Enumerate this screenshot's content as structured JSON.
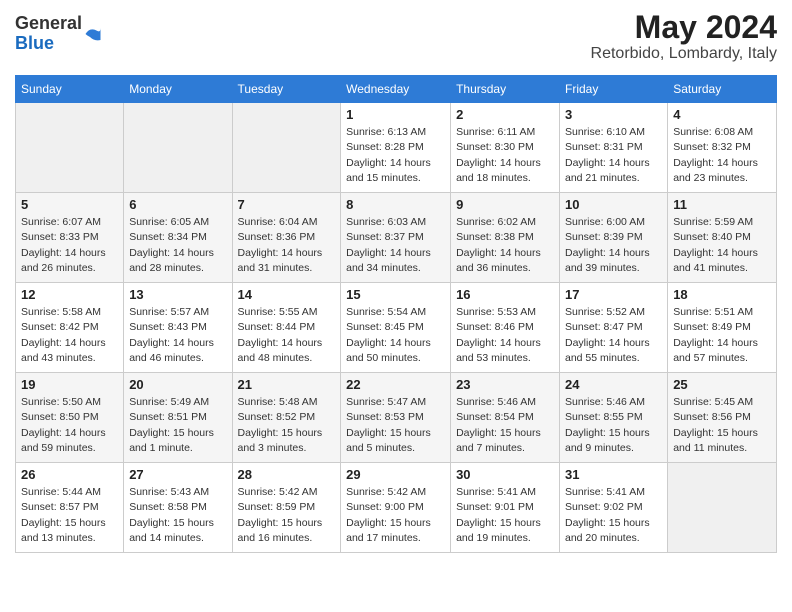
{
  "logo": {
    "general": "General",
    "blue": "Blue"
  },
  "title": {
    "month_year": "May 2024",
    "location": "Retorbido, Lombardy, Italy"
  },
  "weekdays": [
    "Sunday",
    "Monday",
    "Tuesday",
    "Wednesday",
    "Thursday",
    "Friday",
    "Saturday"
  ],
  "weeks": [
    [
      null,
      null,
      null,
      {
        "day": 1,
        "sunrise": "6:13 AM",
        "sunset": "8:28 PM",
        "daylight": "14 hours and 15 minutes."
      },
      {
        "day": 2,
        "sunrise": "6:11 AM",
        "sunset": "8:30 PM",
        "daylight": "14 hours and 18 minutes."
      },
      {
        "day": 3,
        "sunrise": "6:10 AM",
        "sunset": "8:31 PM",
        "daylight": "14 hours and 21 minutes."
      },
      {
        "day": 4,
        "sunrise": "6:08 AM",
        "sunset": "8:32 PM",
        "daylight": "14 hours and 23 minutes."
      }
    ],
    [
      {
        "day": 5,
        "sunrise": "6:07 AM",
        "sunset": "8:33 PM",
        "daylight": "14 hours and 26 minutes."
      },
      {
        "day": 6,
        "sunrise": "6:05 AM",
        "sunset": "8:34 PM",
        "daylight": "14 hours and 28 minutes."
      },
      {
        "day": 7,
        "sunrise": "6:04 AM",
        "sunset": "8:36 PM",
        "daylight": "14 hours and 31 minutes."
      },
      {
        "day": 8,
        "sunrise": "6:03 AM",
        "sunset": "8:37 PM",
        "daylight": "14 hours and 34 minutes."
      },
      {
        "day": 9,
        "sunrise": "6:02 AM",
        "sunset": "8:38 PM",
        "daylight": "14 hours and 36 minutes."
      },
      {
        "day": 10,
        "sunrise": "6:00 AM",
        "sunset": "8:39 PM",
        "daylight": "14 hours and 39 minutes."
      },
      {
        "day": 11,
        "sunrise": "5:59 AM",
        "sunset": "8:40 PM",
        "daylight": "14 hours and 41 minutes."
      }
    ],
    [
      {
        "day": 12,
        "sunrise": "5:58 AM",
        "sunset": "8:42 PM",
        "daylight": "14 hours and 43 minutes."
      },
      {
        "day": 13,
        "sunrise": "5:57 AM",
        "sunset": "8:43 PM",
        "daylight": "14 hours and 46 minutes."
      },
      {
        "day": 14,
        "sunrise": "5:55 AM",
        "sunset": "8:44 PM",
        "daylight": "14 hours and 48 minutes."
      },
      {
        "day": 15,
        "sunrise": "5:54 AM",
        "sunset": "8:45 PM",
        "daylight": "14 hours and 50 minutes."
      },
      {
        "day": 16,
        "sunrise": "5:53 AM",
        "sunset": "8:46 PM",
        "daylight": "14 hours and 53 minutes."
      },
      {
        "day": 17,
        "sunrise": "5:52 AM",
        "sunset": "8:47 PM",
        "daylight": "14 hours and 55 minutes."
      },
      {
        "day": 18,
        "sunrise": "5:51 AM",
        "sunset": "8:49 PM",
        "daylight": "14 hours and 57 minutes."
      }
    ],
    [
      {
        "day": 19,
        "sunrise": "5:50 AM",
        "sunset": "8:50 PM",
        "daylight": "14 hours and 59 minutes."
      },
      {
        "day": 20,
        "sunrise": "5:49 AM",
        "sunset": "8:51 PM",
        "daylight": "15 hours and 1 minute."
      },
      {
        "day": 21,
        "sunrise": "5:48 AM",
        "sunset": "8:52 PM",
        "daylight": "15 hours and 3 minutes."
      },
      {
        "day": 22,
        "sunrise": "5:47 AM",
        "sunset": "8:53 PM",
        "daylight": "15 hours and 5 minutes."
      },
      {
        "day": 23,
        "sunrise": "5:46 AM",
        "sunset": "8:54 PM",
        "daylight": "15 hours and 7 minutes."
      },
      {
        "day": 24,
        "sunrise": "5:46 AM",
        "sunset": "8:55 PM",
        "daylight": "15 hours and 9 minutes."
      },
      {
        "day": 25,
        "sunrise": "5:45 AM",
        "sunset": "8:56 PM",
        "daylight": "15 hours and 11 minutes."
      }
    ],
    [
      {
        "day": 26,
        "sunrise": "5:44 AM",
        "sunset": "8:57 PM",
        "daylight": "15 hours and 13 minutes."
      },
      {
        "day": 27,
        "sunrise": "5:43 AM",
        "sunset": "8:58 PM",
        "daylight": "15 hours and 14 minutes."
      },
      {
        "day": 28,
        "sunrise": "5:42 AM",
        "sunset": "8:59 PM",
        "daylight": "15 hours and 16 minutes."
      },
      {
        "day": 29,
        "sunrise": "5:42 AM",
        "sunset": "9:00 PM",
        "daylight": "15 hours and 17 minutes."
      },
      {
        "day": 30,
        "sunrise": "5:41 AM",
        "sunset": "9:01 PM",
        "daylight": "15 hours and 19 minutes."
      },
      {
        "day": 31,
        "sunrise": "5:41 AM",
        "sunset": "9:02 PM",
        "daylight": "15 hours and 20 minutes."
      },
      null
    ]
  ]
}
